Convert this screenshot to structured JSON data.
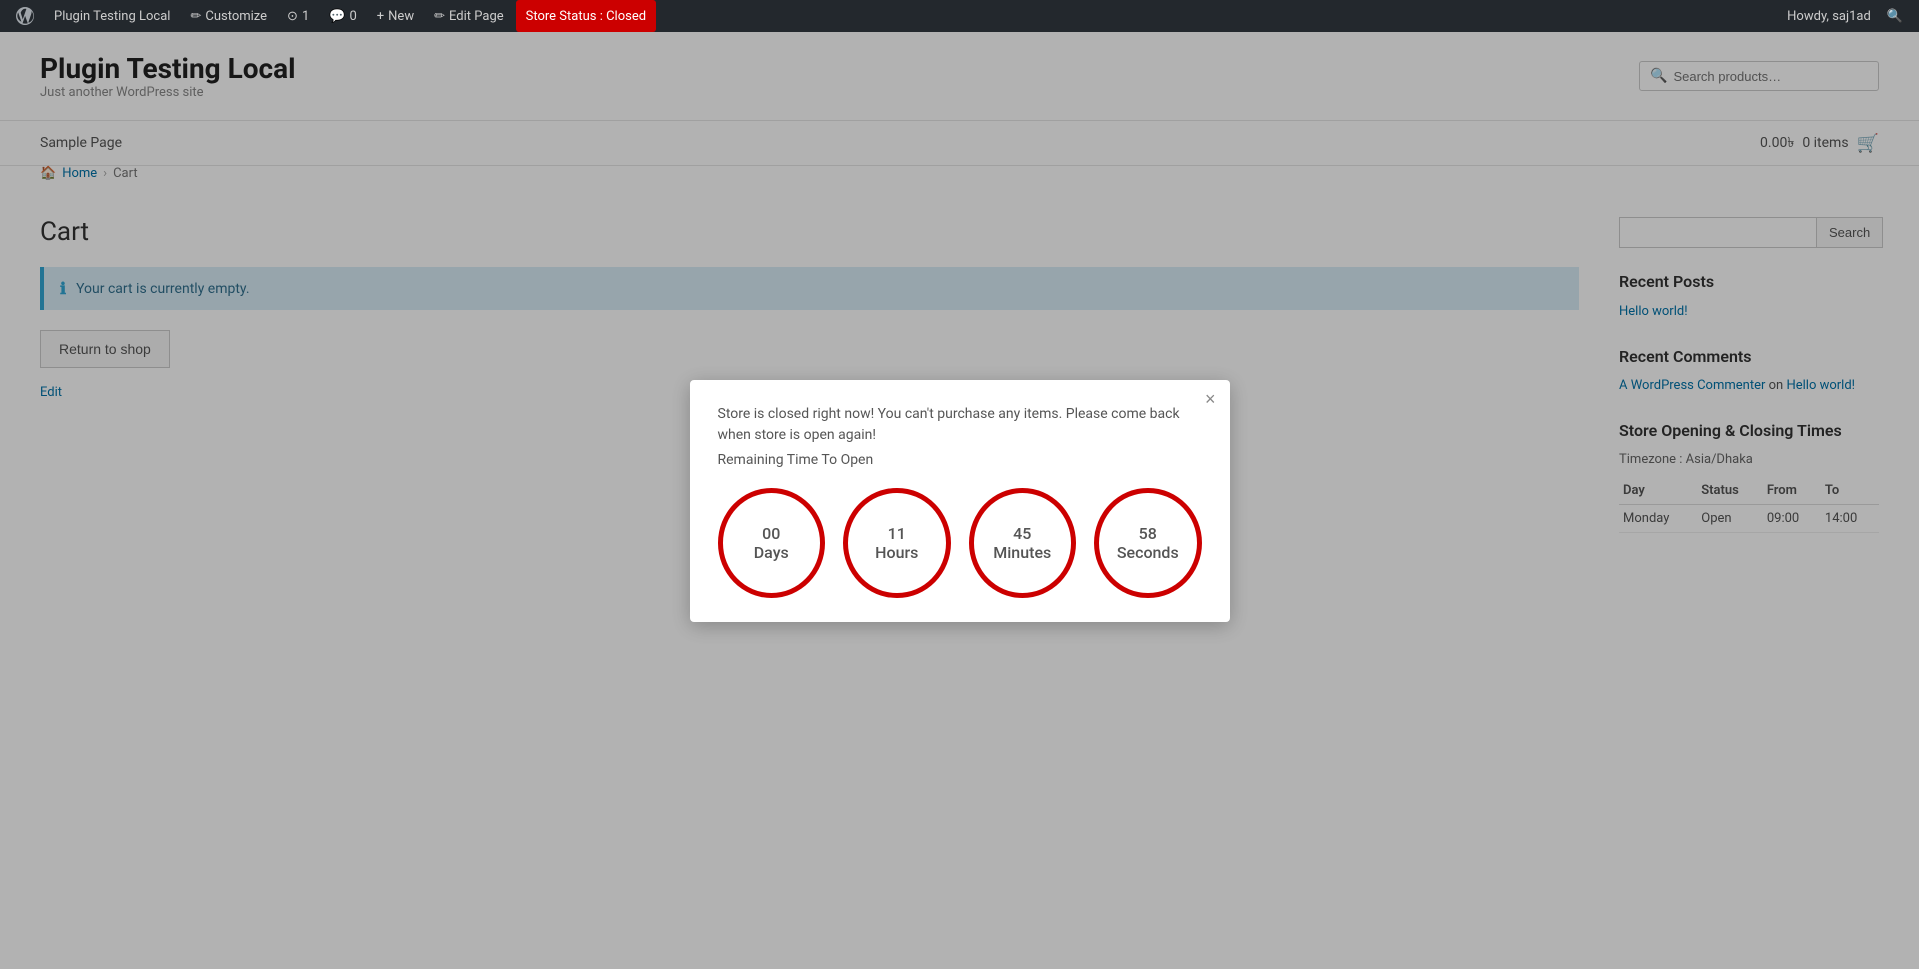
{
  "adminbar": {
    "wp_logo": "⊞",
    "site_name": "Plugin Testing Local",
    "customize_label": "Customize",
    "pages_count": "1",
    "comments_count": "0",
    "new_label": "New",
    "edit_page_label": "Edit Page",
    "store_status_label": "Store Status : Closed",
    "howdy": "Howdy, saj1ad",
    "search_icon": "🔍"
  },
  "header": {
    "site_title": "Plugin Testing Local",
    "site_tagline": "Just another WordPress site",
    "search_placeholder": "Search products…"
  },
  "nav": {
    "links": [
      {
        "label": "Sample Page"
      }
    ],
    "cart_price": "0.00৳",
    "cart_items": "0 items"
  },
  "breadcrumb": {
    "home": "Home",
    "separator": "›",
    "current": "Cart"
  },
  "main": {
    "page_title": "Cart",
    "cart_notice": "Your cart is currently empty.",
    "return_btn_label": "Return to shop",
    "edit_label": "Edit"
  },
  "sidebar": {
    "search_placeholder": "",
    "search_btn_label": "Search",
    "recent_posts_title": "Recent Posts",
    "recent_posts": [
      {
        "label": "Hello world!"
      }
    ],
    "recent_comments_title": "Recent Comments",
    "recent_comments": [
      {
        "commenter": "A WordPress Commenter",
        "on": "on",
        "post": "Hello world!"
      }
    ],
    "store_hours_title": "Store Opening & Closing Times",
    "timezone_label": "Timezone : Asia/Dhaka",
    "hours_table": {
      "headers": [
        "Day",
        "Status",
        "From",
        "To"
      ],
      "rows": [
        {
          "day": "Monday",
          "status": "Open",
          "from": "09:00",
          "to": "14:00"
        }
      ]
    }
  },
  "modal": {
    "message": "Store is closed right now! You can't purchase any items. Please come back when store is open again!",
    "remaining_label": "Remaining Time To Open",
    "close_icon": "×",
    "countdown": [
      {
        "value": "00",
        "unit": "Days"
      },
      {
        "value": "11",
        "unit": "Hours"
      },
      {
        "value": "45",
        "unit": "Minutes"
      },
      {
        "value": "58",
        "unit": "Seconds"
      }
    ]
  },
  "colors": {
    "red": "#cc0000",
    "blue_link": "#0073aa",
    "admin_bar": "#23282d"
  }
}
